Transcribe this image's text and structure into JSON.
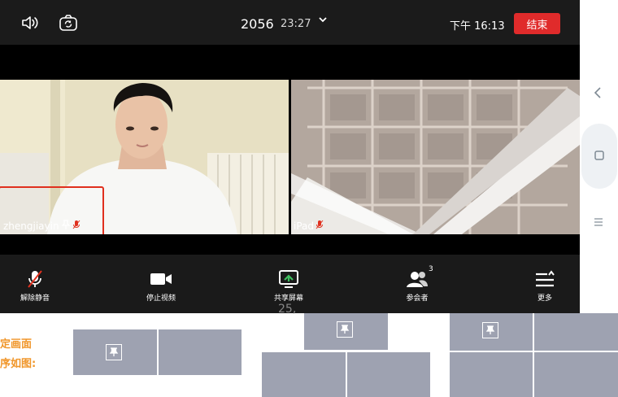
{
  "header": {
    "meeting_id": "2056",
    "duration": "23:27",
    "clock": "下午 16:13",
    "end_label": "结束"
  },
  "participants": [
    {
      "name": "zhengjiayin"
    },
    {
      "name": "iPad"
    }
  ],
  "toolbar": {
    "unmute_label": "解除静音",
    "stop_video_label": "停止视频",
    "share_screen_label": "共享屏幕",
    "participants_label": "参会者",
    "participants_count": "3",
    "more_label": "更多"
  },
  "document": {
    "caption_line1": "定画面",
    "caption_line2": "序如图:",
    "partial_text": "25,"
  },
  "colors": {
    "end_button": "#e02b2b",
    "highlight_box": "#e0301e",
    "layout_box": "#9ea2b1",
    "caption": "#f0962a"
  }
}
